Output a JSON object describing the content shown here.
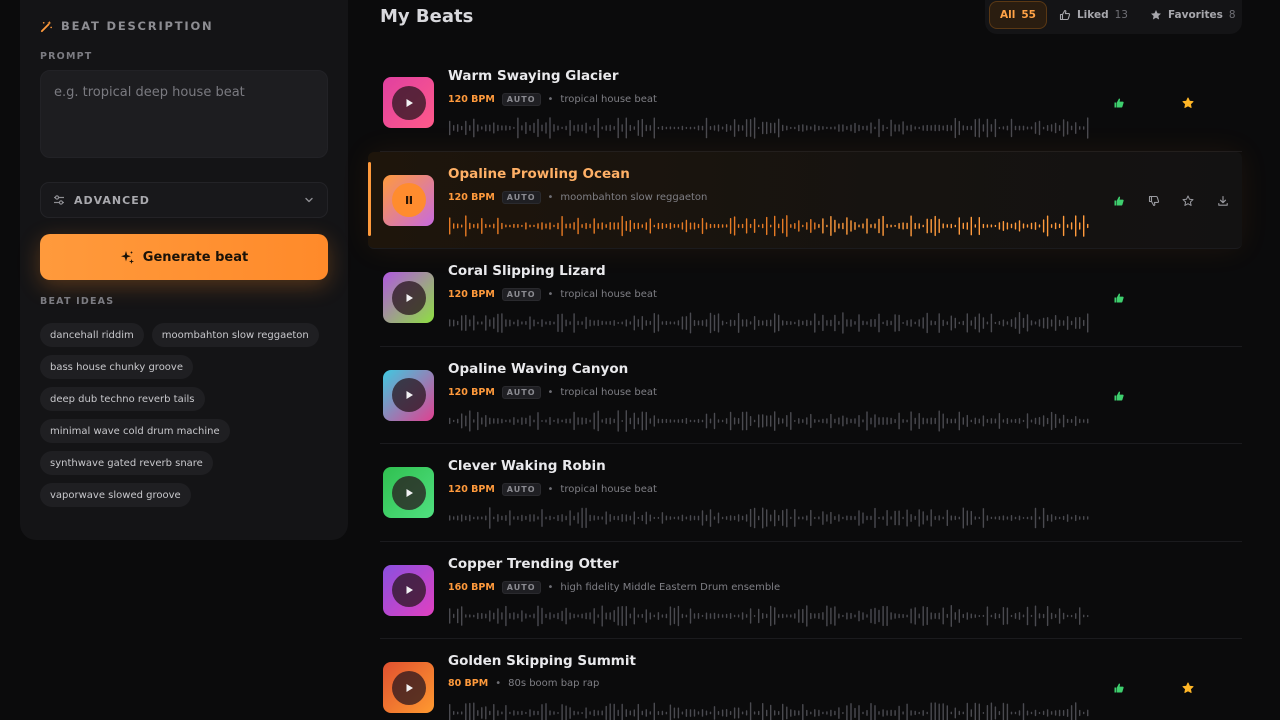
{
  "sidebar": {
    "title": "BEAT DESCRIPTION",
    "prompt_label": "PROMPT",
    "prompt_placeholder": "e.g. tropical deep house beat",
    "prompt_value": "",
    "advanced_label": "ADVANCED",
    "generate_label": "Generate beat",
    "ideas_label": "BEAT IDEAS",
    "ideas": [
      "dancehall riddim",
      "moombahton slow reggaeton",
      "bass house chunky groove",
      "deep dub techno reverb tails",
      "minimal wave cold drum machine",
      "synthwave gated reverb snare",
      "vaporwave slowed groove"
    ]
  },
  "main": {
    "title": "My Beats",
    "filters": [
      {
        "label": "All",
        "count": "55",
        "icon": "none",
        "active": true
      },
      {
        "label": "Liked",
        "count": "13",
        "icon": "thumbs-up-icon",
        "active": false
      },
      {
        "label": "Favorites",
        "count": "8",
        "icon": "star-icon",
        "active": false
      }
    ]
  },
  "beats": [
    {
      "title": "Warm Swaying Glacier",
      "bpm": "120 BPM",
      "auto": "AUTO",
      "desc": "tropical house beat",
      "playing": false,
      "liked": true,
      "favorite": true,
      "hover": false,
      "grad": [
        "#e040a0",
        "#ff5a8a"
      ]
    },
    {
      "title": "Opaline Prowling Ocean",
      "bpm": "120 BPM",
      "auto": "AUTO",
      "desc": "moombahton slow reggaeton",
      "playing": true,
      "progress": 0.57,
      "liked": true,
      "favorite": false,
      "hover": true,
      "grad": [
        "#ff9a3c",
        "#c86adf"
      ]
    },
    {
      "title": "Coral Slipping Lizard",
      "bpm": "120 BPM",
      "auto": "AUTO",
      "desc": "tropical house beat",
      "playing": false,
      "liked": true,
      "favorite": false,
      "hover": false,
      "grad": [
        "#b058e0",
        "#8ee040"
      ]
    },
    {
      "title": "Opaline Waving Canyon",
      "bpm": "120 BPM",
      "auto": "AUTO",
      "desc": "tropical house beat",
      "playing": false,
      "liked": true,
      "favorite": false,
      "hover": false,
      "grad": [
        "#40c8e0",
        "#e04090"
      ]
    },
    {
      "title": "Clever Waking Robin",
      "bpm": "120 BPM",
      "auto": "AUTO",
      "desc": "tropical house beat",
      "playing": false,
      "liked": false,
      "favorite": false,
      "hover": false,
      "grad": [
        "#30c050",
        "#50e080"
      ]
    },
    {
      "title": "Copper Trending Otter",
      "bpm": "160 BPM",
      "auto": "AUTO",
      "desc": "high fidelity Middle Eastern Drum ensemble",
      "playing": false,
      "liked": false,
      "favorite": false,
      "hover": false,
      "grad": [
        "#8a50e0",
        "#e040c0"
      ]
    },
    {
      "title": "Golden Skipping Summit",
      "bpm": "80 BPM",
      "auto": "",
      "desc": "80s boom bap rap",
      "playing": false,
      "liked": true,
      "favorite": true,
      "hover": false,
      "grad": [
        "#e05030",
        "#ff9a30"
      ]
    }
  ],
  "colors": {
    "accent": "#ff9a3c",
    "liked": "#3ecf6e",
    "favorite": "#ffb627",
    "wave_idle": "#4a4a50"
  }
}
